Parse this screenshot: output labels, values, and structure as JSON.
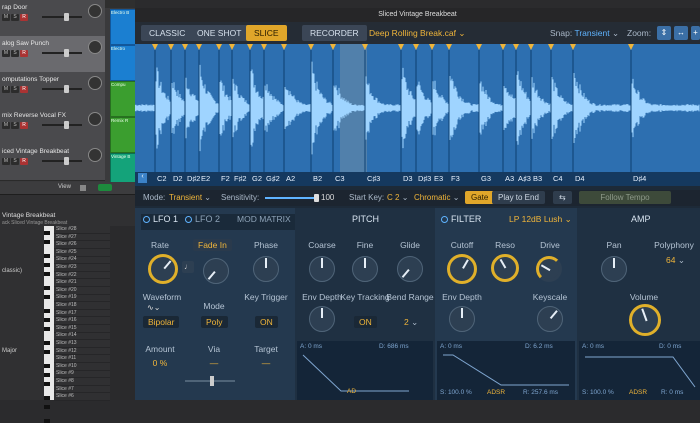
{
  "tracks": [
    {
      "name": "rap Door",
      "region": "Electro B"
    },
    {
      "name": "alog Saw Punch",
      "region": "Electro"
    },
    {
      "name": "omputations Topper",
      "region": "Compu"
    },
    {
      "name": "mix Reverse Vocal FX",
      "region": "Remix R"
    },
    {
      "name": "iced Vintage Breakbeat",
      "region": "Vintage B"
    }
  ],
  "lower_left": {
    "view_label": "View",
    "inspector_title": "Vintage Breakbeat",
    "inspector_sub": "ack Sliced Vintage Breakbeat",
    "classic_label": "classic)",
    "major_label": "Major",
    "c4_label": "C4",
    "c3_label": "C3",
    "c2_label": "C2",
    "slices": [
      "Slice #28",
      "Slice #27",
      "Slice #26",
      "Slice #25",
      "Slice #24",
      "Slice #23",
      "Slice #22",
      "Slice #21",
      "Slice #20",
      "Slice #19",
      "Slice #18",
      "Slice #17",
      "Slice #16",
      "Slice #15",
      "Slice #14",
      "Slice #13",
      "Slice #12",
      "Slice #11",
      "Slice #10",
      "Slice #9",
      "Slice #8",
      "Slice #7",
      "Slice #6"
    ]
  },
  "plugin": {
    "title": "Sliced Vintage Breakbeat",
    "tabs": [
      "CLASSIC",
      "ONE SHOT",
      "SLICE",
      "RECORDER"
    ],
    "active_tab": "SLICE",
    "file": "Deep Rolling Break.caf",
    "snap_label": "Snap:",
    "snap_value": "Transient",
    "zoom_label": "Zoom:",
    "notes": [
      "C2",
      "D2",
      "D♯2",
      "E2",
      "F2",
      "F♯2",
      "G2",
      "G♯2",
      "A2",
      "B2",
      "C3",
      "C♯3",
      "D3",
      "D♯3",
      "E3",
      "F3",
      "G3",
      "A3",
      "A♯3",
      "B3",
      "C4",
      "D4",
      "D♯4"
    ],
    "mode_bar": {
      "mode_label": "Mode:",
      "mode_value": "Transient",
      "sensitivity_label": "Sensitivity:",
      "sensitivity_value": "100",
      "start_key_label": "Start Key:",
      "start_key_value": "C 2",
      "chromatic": "Chromatic",
      "gate": "Gate",
      "play_to_end": "Play to End",
      "follow_tempo": "Follow Tempo"
    },
    "lfo": {
      "lfo1": "LFO 1",
      "lfo2": "LFO 2",
      "mod_matrix": "MOD MATRIX",
      "rate": "Rate",
      "fade_in": "Fade In",
      "phase": "Phase",
      "waveform": "Waveform",
      "waveform_value": "Bipolar",
      "mode": "Mode",
      "mode_value": "Poly",
      "key_trigger": "Key Trigger",
      "key_trigger_value": "ON",
      "amount": "Amount",
      "amount_value": "0 %",
      "via": "Via",
      "via_value": "—",
      "target": "Target",
      "target_value": "—"
    },
    "pitch": {
      "title": "PITCH",
      "coarse": "Coarse",
      "fine": "Fine",
      "glide": "Glide",
      "env_depth": "Env Depth",
      "key_tracking": "Key Tracking",
      "key_tracking_value": "ON",
      "bend_range": "Bend Range",
      "bend_range_value": "2",
      "env_a": "A: 0 ms",
      "env_d": "D: 686 ms",
      "env_mode": "AD"
    },
    "filter": {
      "title": "FILTER",
      "type": "LP 12dB Lush",
      "cutoff": "Cutoff",
      "reso": "Reso",
      "drive": "Drive",
      "env_depth": "Env Depth",
      "keyscale": "Keyscale",
      "env_a": "A: 0 ms",
      "env_d": "D: 6.2 ms",
      "env_s": "S: 100.0 %",
      "env_r": "R: 257.6 ms",
      "env_mode": "ADSR"
    },
    "amp": {
      "title": "AMP",
      "pan": "Pan",
      "polyphony": "Polyphony",
      "polyphony_value": "64",
      "volume": "Volume",
      "env_a": "A: 0 ms",
      "env_d": "D: 0 ms",
      "env_s": "S: 100.0 %",
      "env_r": "R: 0 ms",
      "env_mode": "ADSR"
    }
  }
}
